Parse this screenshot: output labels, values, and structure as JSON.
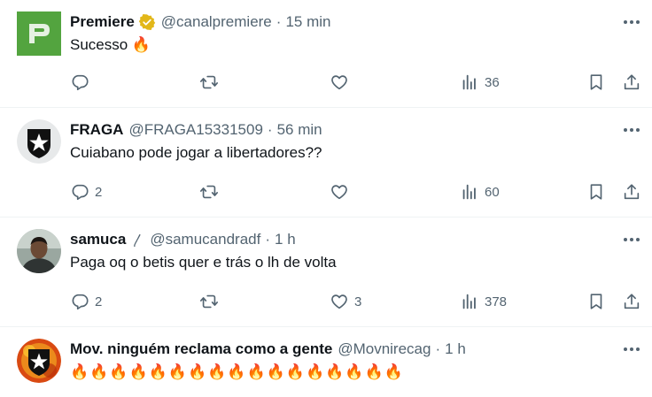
{
  "tweets": [
    {
      "name": "Premiere",
      "handle": "@canalpremiere",
      "dot": "·",
      "time": "15 min",
      "text": "Sucesso 🔥",
      "reply_count": "",
      "retweet_count": "",
      "like_count": "",
      "views": "36",
      "avatar_icon": "premiere-logo",
      "verified": true
    },
    {
      "name": "FRAGA",
      "handle": "@FRAGA15331509",
      "dot": "·",
      "time": "56 min",
      "text": "Cuiabano pode jogar a libertadores??",
      "reply_count": "2",
      "retweet_count": "",
      "like_count": "",
      "views": "60",
      "avatar_icon": "botafogo-star-crest"
    },
    {
      "name": "samuca",
      "name_badge": "〳",
      "handle": "@samucandradf",
      "dot": "·",
      "time": "1 h",
      "text": "Paga oq o betis quer e trás o lh de volta",
      "reply_count": "2",
      "retweet_count": "",
      "like_count": "3",
      "views": "378",
      "avatar_icon": "user-photo"
    },
    {
      "name": "Mov. ninguém reclama como a gente",
      "handle": "@Movnirecag",
      "dot": "·",
      "time": "1 h",
      "text": "🔥🔥🔥🔥🔥🔥🔥🔥🔥🔥🔥🔥🔥🔥🔥🔥🔥",
      "avatar_icon": "botafogo-star-fire-crest"
    }
  ],
  "more_label": "···",
  "colors": {
    "text": "#0f1419",
    "muted": "#536471",
    "divider": "#eff3f4",
    "verified_gold": "#e2b719"
  }
}
